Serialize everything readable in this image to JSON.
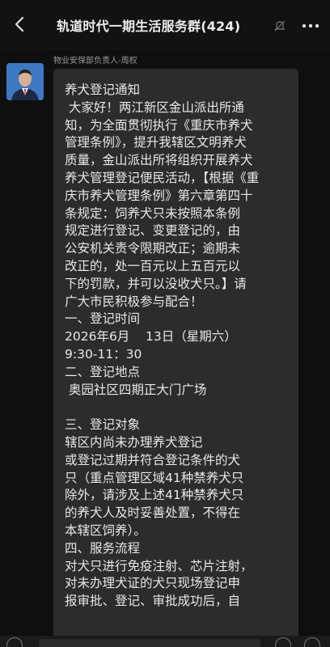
{
  "header": {
    "back_icon": "chevron-left-icon",
    "title": "轨道时代一期生活服务群(424)",
    "mute_icon": "bell-off-icon",
    "more_icon": "more-icon"
  },
  "message": {
    "sender_name": "物业安保部负责人-周权",
    "lines": [
      "养犬登记通知",
      " 大家好！两江新区金山派出所通",
      "知，为全面贯彻执行《重庆市养犬",
      "管理条例》，提升我辖区文明养犬",
      "质量，金山派出所将组织开展养犬",
      "养犬管理登记便民活动，【根据《重",
      "庆市养犬管理条例》第六章第四十",
      "条规定：饲养犬只未按照本条例",
      "规定进行登记、变更登记的，由",
      "公安机关责令限期改正；逾期未",
      "改正的，处一百元以上五百元以",
      "下的罚款，并可以没收犬只。】请",
      "广大市民积极参与配合！",
      "一、登记时间",
      "2026年6月    13日（星期六）",
      "9:30-11：30",
      "二、登记地点",
      " 奥园社区四期正大门广场",
      "",
      "三、登记对象",
      "辖区内尚未办理养犬登记",
      "或登记过期并符合登记条件的犬",
      "只（重点管理区域41种禁养犬只",
      "除外，请涉及上述41种禁养犬只",
      "的养犬人及时妥善处置，不得在",
      "本辖区饲养）。",
      "四、服务流程",
      "对犬只进行免疫注射、芯片注射，",
      "对未办理犬证的犬只现场登记申",
      "报审批、登记、审批成功后，自"
    ]
  },
  "colors": {
    "background": "#0f0f0f",
    "bubble": "#2c2c2c",
    "text": "#e8e8e8"
  }
}
